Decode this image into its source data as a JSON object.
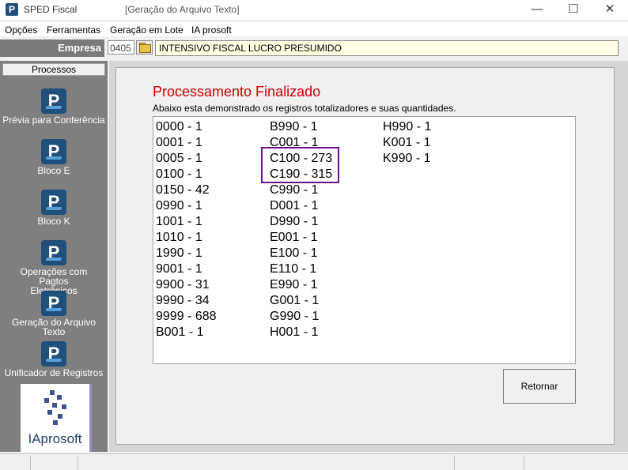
{
  "window": {
    "app_title": "SPED Fiscal",
    "doc_title": "[Geração do Arquivo Texto]",
    "minimize_glyph": "—",
    "maximize_glyph": "☐",
    "close_glyph": "✕"
  },
  "menu": [
    "Opções",
    "Ferramentas",
    "Geração em Lote",
    "IA prosoft"
  ],
  "empresa": {
    "label": "Empresa",
    "code": "0405",
    "name": "INTENSIVO FISCAL LUCRO PRESUMIDO"
  },
  "sidebar": {
    "header": "Processos",
    "items": [
      {
        "icon": "P",
        "label": "Prévia para Conferência"
      },
      {
        "icon": "P",
        "label": "Bloco E"
      },
      {
        "icon": "P",
        "label": "Bloco K"
      },
      {
        "icon": "P",
        "label": "Operações com Pagtos Eletrônicos"
      },
      {
        "icon": "P",
        "label": "Geração do Arquivo Texto"
      },
      {
        "icon": "P",
        "label": "Unificador de Registros"
      }
    ],
    "logo_text": "IAprosoft"
  },
  "main": {
    "title": "Processamento Finalizado",
    "subtitle": "Abaixo esta demonstrado os registros totalizadores e suas quantidades.",
    "columns": [
      [
        "0000 - 1",
        "0001 - 1",
        "0005 - 1",
        "0100 - 1",
        "0150 - 42",
        "0990 - 1",
        "1001 - 1",
        "1010 - 1",
        "1990 - 1",
        "9001 - 1",
        "9900 - 31",
        "9990 - 34",
        "9999 - 688",
        "B001 - 1"
      ],
      [
        "B990 - 1",
        "C001 - 1",
        "C100 - 273",
        "C190 - 315",
        "C990 - 1",
        "D001 - 1",
        "D990 - 1",
        "E001 - 1",
        "E100 - 1",
        "E110 - 1",
        "E990 - 1",
        "G001 - 1",
        "G990 - 1",
        "H001 - 1"
      ],
      [
        "H990 - 1",
        "K001 - 1",
        "K990 - 1"
      ]
    ],
    "return_button": "Retornar"
  },
  "colors": {
    "title_red": "#d00000",
    "highlight_purple": "#6a0f8e",
    "sidebar_gray": "#7f7f7f",
    "empresa_name_bg": "#ffffe1"
  }
}
